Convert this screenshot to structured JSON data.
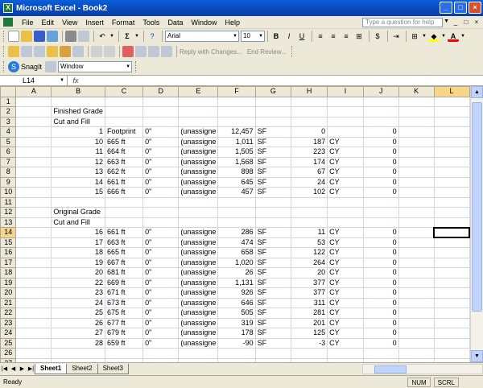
{
  "window": {
    "title": "Microsoft Excel - Book2",
    "buttons": [
      "_",
      "□",
      "×"
    ]
  },
  "menu": {
    "items": [
      "File",
      "Edit",
      "View",
      "Insert",
      "Format",
      "Tools",
      "Data",
      "Window",
      "Help"
    ],
    "help_placeholder": "Type a question for help"
  },
  "toolbar": {
    "sum_label": "Σ",
    "font_name": "Arial",
    "font_size": "10",
    "bold": "B",
    "italic": "I",
    "underline": "U",
    "currency": "$",
    "reply_label": "Reply with Changes...",
    "end_review_label": "End Review...",
    "snagit_label": "SnagIt",
    "window_combo": "Window"
  },
  "formula_bar": {
    "name_box": "L14",
    "fx": "fx",
    "value": ""
  },
  "grid": {
    "columns": [
      "A",
      "B",
      "C",
      "D",
      "E",
      "F",
      "G",
      "H",
      "I",
      "J",
      "K",
      "L"
    ],
    "rows": [
      {
        "n": "1",
        "A": "",
        "B": "",
        "C": "",
        "D": "",
        "E": "",
        "F": "",
        "G": "",
        "H": "",
        "I": "",
        "J": "",
        "K": ""
      },
      {
        "n": "2",
        "A": "",
        "B": "Finished Grade",
        "C": "",
        "D": "",
        "E": "",
        "F": "",
        "G": "",
        "H": "",
        "I": "",
        "J": "",
        "K": ""
      },
      {
        "n": "3",
        "A": "",
        "B": "Cut and Fill",
        "C": "",
        "D": "",
        "E": "",
        "F": "",
        "G": "",
        "H": "",
        "I": "",
        "J": "",
        "K": ""
      },
      {
        "n": "4",
        "A": "",
        "B": "1",
        "C": "Footprint",
        "D": "0\"",
        "E": "(unassigne",
        "F": "12,457",
        "G": "SF",
        "H": "0",
        "I": "",
        "J": "0",
        "K": ""
      },
      {
        "n": "5",
        "A": "",
        "B": "10",
        "C": "665 ft",
        "D": "0\"",
        "E": "(unassigne",
        "F": "1,011",
        "G": "SF",
        "H": "187",
        "I": "CY",
        "J": "0",
        "K": ""
      },
      {
        "n": "6",
        "A": "",
        "B": "11",
        "C": "664 ft",
        "D": "0\"",
        "E": "(unassigne",
        "F": "1,505",
        "G": "SF",
        "H": "223",
        "I": "CY",
        "J": "0",
        "K": ""
      },
      {
        "n": "7",
        "A": "",
        "B": "12",
        "C": "663 ft",
        "D": "0\"",
        "E": "(unassigne",
        "F": "1,568",
        "G": "SF",
        "H": "174",
        "I": "CY",
        "J": "0",
        "K": ""
      },
      {
        "n": "8",
        "A": "",
        "B": "13",
        "C": "662 ft",
        "D": "0\"",
        "E": "(unassigne",
        "F": "898",
        "G": "SF",
        "H": "67",
        "I": "CY",
        "J": "0",
        "K": ""
      },
      {
        "n": "9",
        "A": "",
        "B": "14",
        "C": "661 ft",
        "D": "0\"",
        "E": "(unassigne",
        "F": "645",
        "G": "SF",
        "H": "24",
        "I": "CY",
        "J": "0",
        "K": ""
      },
      {
        "n": "10",
        "A": "",
        "B": "15",
        "C": "666 ft",
        "D": "0\"",
        "E": "(unassigne",
        "F": "457",
        "G": "SF",
        "H": "102",
        "I": "CY",
        "J": "0",
        "K": ""
      },
      {
        "n": "11",
        "A": "",
        "B": "",
        "C": "",
        "D": "",
        "E": "",
        "F": "",
        "G": "",
        "H": "",
        "I": "",
        "J": "",
        "K": ""
      },
      {
        "n": "12",
        "A": "",
        "B": "Original Grade",
        "C": "",
        "D": "",
        "E": "",
        "F": "",
        "G": "",
        "H": "",
        "I": "",
        "J": "",
        "K": ""
      },
      {
        "n": "13",
        "A": "",
        "B": "Cut and Fill",
        "C": "",
        "D": "",
        "E": "",
        "F": "",
        "G": "",
        "H": "",
        "I": "",
        "J": "",
        "K": ""
      },
      {
        "n": "14",
        "A": "",
        "B": "16",
        "C": "661 ft",
        "D": "0\"",
        "E": "(unassigne",
        "F": "286",
        "G": "SF",
        "H": "11",
        "I": "CY",
        "J": "0",
        "K": ""
      },
      {
        "n": "15",
        "A": "",
        "B": "17",
        "C": "663 ft",
        "D": "0\"",
        "E": "(unassigne",
        "F": "474",
        "G": "SF",
        "H": "53",
        "I": "CY",
        "J": "0",
        "K": ""
      },
      {
        "n": "16",
        "A": "",
        "B": "18",
        "C": "665 ft",
        "D": "0\"",
        "E": "(unassigne",
        "F": "658",
        "G": "SF",
        "H": "122",
        "I": "CY",
        "J": "0",
        "K": ""
      },
      {
        "n": "17",
        "A": "",
        "B": "19",
        "C": "667 ft",
        "D": "0\"",
        "E": "(unassigne",
        "F": "1,020",
        "G": "SF",
        "H": "264",
        "I": "CY",
        "J": "0",
        "K": ""
      },
      {
        "n": "18",
        "A": "",
        "B": "20",
        "C": "681 ft",
        "D": "0\"",
        "E": "(unassigne",
        "F": "26",
        "G": "SF",
        "H": "20",
        "I": "CY",
        "J": "0",
        "K": ""
      },
      {
        "n": "19",
        "A": "",
        "B": "22",
        "C": "669 ft",
        "D": "0\"",
        "E": "(unassigne",
        "F": "1,131",
        "G": "SF",
        "H": "377",
        "I": "CY",
        "J": "0",
        "K": ""
      },
      {
        "n": "20",
        "A": "",
        "B": "23",
        "C": "671 ft",
        "D": "0\"",
        "E": "(unassigne",
        "F": "926",
        "G": "SF",
        "H": "377",
        "I": "CY",
        "J": "0",
        "K": ""
      },
      {
        "n": "21",
        "A": "",
        "B": "24",
        "C": "673 ft",
        "D": "0\"",
        "E": "(unassigne",
        "F": "646",
        "G": "SF",
        "H": "311",
        "I": "CY",
        "J": "0",
        "K": ""
      },
      {
        "n": "22",
        "A": "",
        "B": "25",
        "C": "675 ft",
        "D": "0\"",
        "E": "(unassigne",
        "F": "505",
        "G": "SF",
        "H": "281",
        "I": "CY",
        "J": "0",
        "K": ""
      },
      {
        "n": "23",
        "A": "",
        "B": "26",
        "C": "677 ft",
        "D": "0\"",
        "E": "(unassigne",
        "F": "319",
        "G": "SF",
        "H": "201",
        "I": "CY",
        "J": "0",
        "K": ""
      },
      {
        "n": "24",
        "A": "",
        "B": "27",
        "C": "679 ft",
        "D": "0\"",
        "E": "(unassigne",
        "F": "178",
        "G": "SF",
        "H": "125",
        "I": "CY",
        "J": "0",
        "K": ""
      },
      {
        "n": "25",
        "A": "",
        "B": "28",
        "C": "659 ft",
        "D": "0\"",
        "E": "(unassigne",
        "F": "-90",
        "G": "SF",
        "H": "-3",
        "I": "CY",
        "J": "0",
        "K": ""
      },
      {
        "n": "26",
        "A": "",
        "B": "",
        "C": "",
        "D": "",
        "E": "",
        "F": "",
        "G": "",
        "H": "",
        "I": "",
        "J": "",
        "K": ""
      },
      {
        "n": "27",
        "A": "",
        "B": "",
        "C": "",
        "D": "",
        "E": "",
        "F": "",
        "G": "",
        "H": "",
        "I": "",
        "J": "",
        "K": ""
      }
    ],
    "active_cell": {
      "row": "14",
      "col": "L"
    }
  },
  "sheets": {
    "tabs": [
      "Sheet1",
      "Sheet2",
      "Sheet3"
    ],
    "active": "Sheet1"
  },
  "status": {
    "left": "Ready",
    "indicators": [
      "NUM",
      "SCRL"
    ]
  }
}
